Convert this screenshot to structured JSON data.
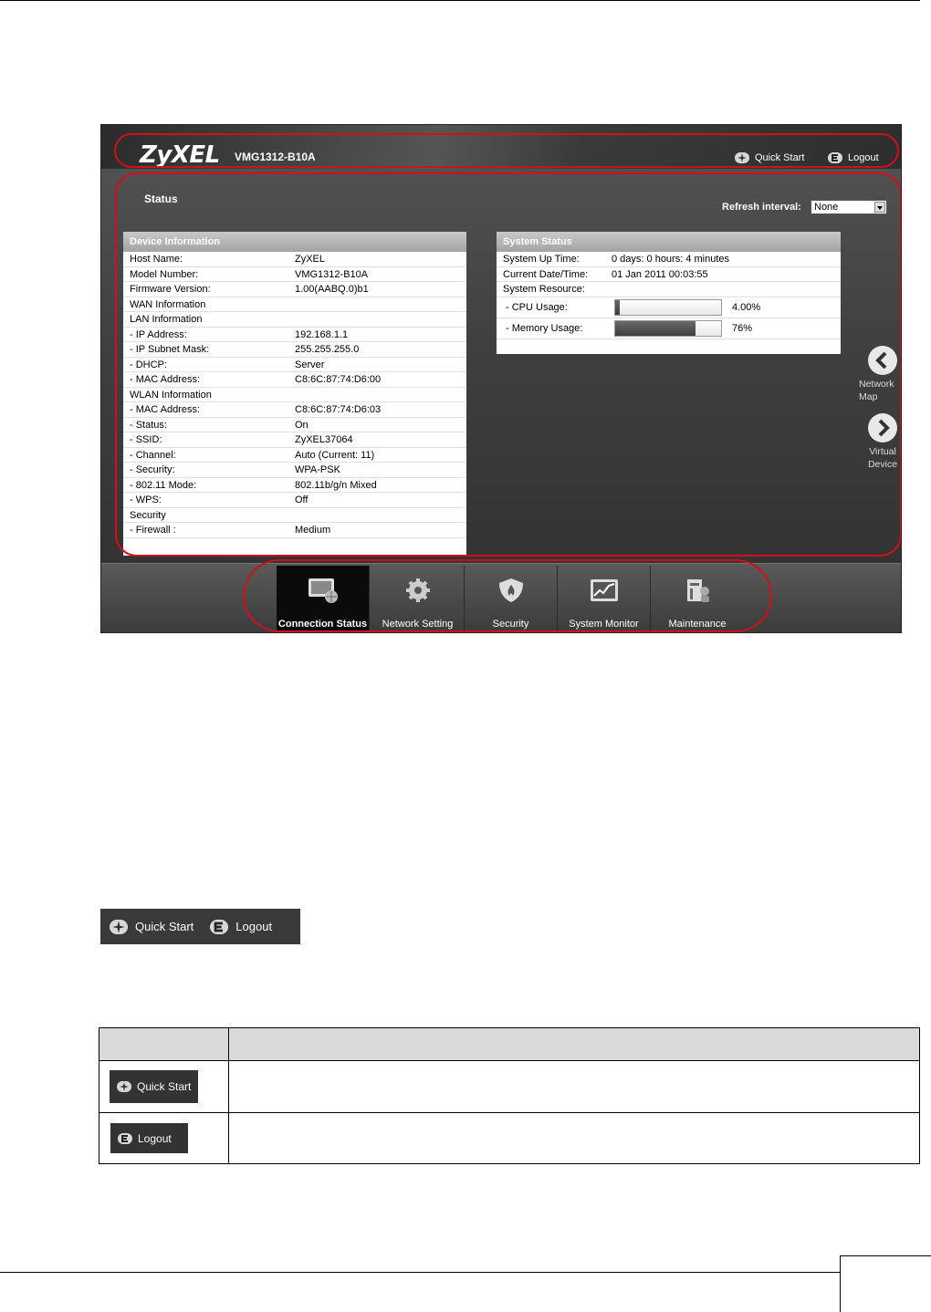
{
  "device": {
    "brand": "ZyXEL",
    "model": "VMG1312-B10A",
    "quick_start": "Quick Start",
    "logout": "Logout",
    "status_title": "Status",
    "refresh_label": "Refresh interval:",
    "refresh_value": "None"
  },
  "device_info": {
    "title": "Device Information",
    "rows": [
      {
        "k": "Host Name:",
        "v": "ZyXEL"
      },
      {
        "k": "Model Number:",
        "v": "VMG1312-B10A"
      },
      {
        "k": "Firmware Version:",
        "v": "1.00(AABQ.0)b1"
      },
      {
        "k": "WAN Information",
        "v": ""
      },
      {
        "k": "LAN Information",
        "v": ""
      },
      {
        "k": "- IP Address:",
        "v": "192.168.1.1"
      },
      {
        "k": "- IP Subnet Mask:",
        "v": "255.255.255.0"
      },
      {
        "k": "- DHCP:",
        "v": "Server"
      },
      {
        "k": "- MAC Address:",
        "v": "C8:6C:87:74:D6:00"
      },
      {
        "k": "WLAN Information",
        "v": ""
      },
      {
        "k": "- MAC Address:",
        "v": "C8:6C:87:74:D6:03"
      },
      {
        "k": "- Status:",
        "v": "On"
      },
      {
        "k": "- SSID:",
        "v": "ZyXEL37064"
      },
      {
        "k": "- Channel:",
        "v": "Auto (Current: 11)"
      },
      {
        "k": "- Security:",
        "v": "WPA-PSK"
      },
      {
        "k": "- 802.11 Mode:",
        "v": "802.11b/g/n Mixed"
      },
      {
        "k": "- WPS:",
        "v": "Off"
      },
      {
        "k": "Security",
        "v": ""
      },
      {
        "k": "- Firewall :",
        "v": "Medium"
      }
    ]
  },
  "system_status": {
    "title": "System Status",
    "rows": [
      {
        "k": "System Up Time:",
        "v": "0 days: 0 hours: 4 minutes"
      },
      {
        "k": "Current Date/Time:",
        "v": "01 Jan 2011 00:03:55"
      },
      {
        "k": "System Resource:",
        "v": ""
      }
    ],
    "cpu": {
      "label": "- CPU Usage:",
      "value_text": "4.00%",
      "fraction": 0.04
    },
    "memory": {
      "label": "- Memory Usage:",
      "value_text": "76%",
      "fraction": 0.76
    }
  },
  "side_nav": {
    "left": "Network Map",
    "right": "Virtual Device"
  },
  "nav": [
    {
      "label": "Connection Status",
      "icon": "monitor-globe-icon",
      "active": true
    },
    {
      "label": "Network Setting",
      "icon": "gear-icon",
      "active": false
    },
    {
      "label": "Security",
      "icon": "shield-icon",
      "active": false
    },
    {
      "label": "System Monitor",
      "icon": "chart-icon",
      "active": false
    },
    {
      "label": "Maintenance",
      "icon": "tools-icon",
      "active": false
    }
  ],
  "doc_buttons": {
    "quick_start": "Quick Start",
    "logout": "Logout"
  },
  "colors": {
    "highlight": "#d0101a"
  }
}
